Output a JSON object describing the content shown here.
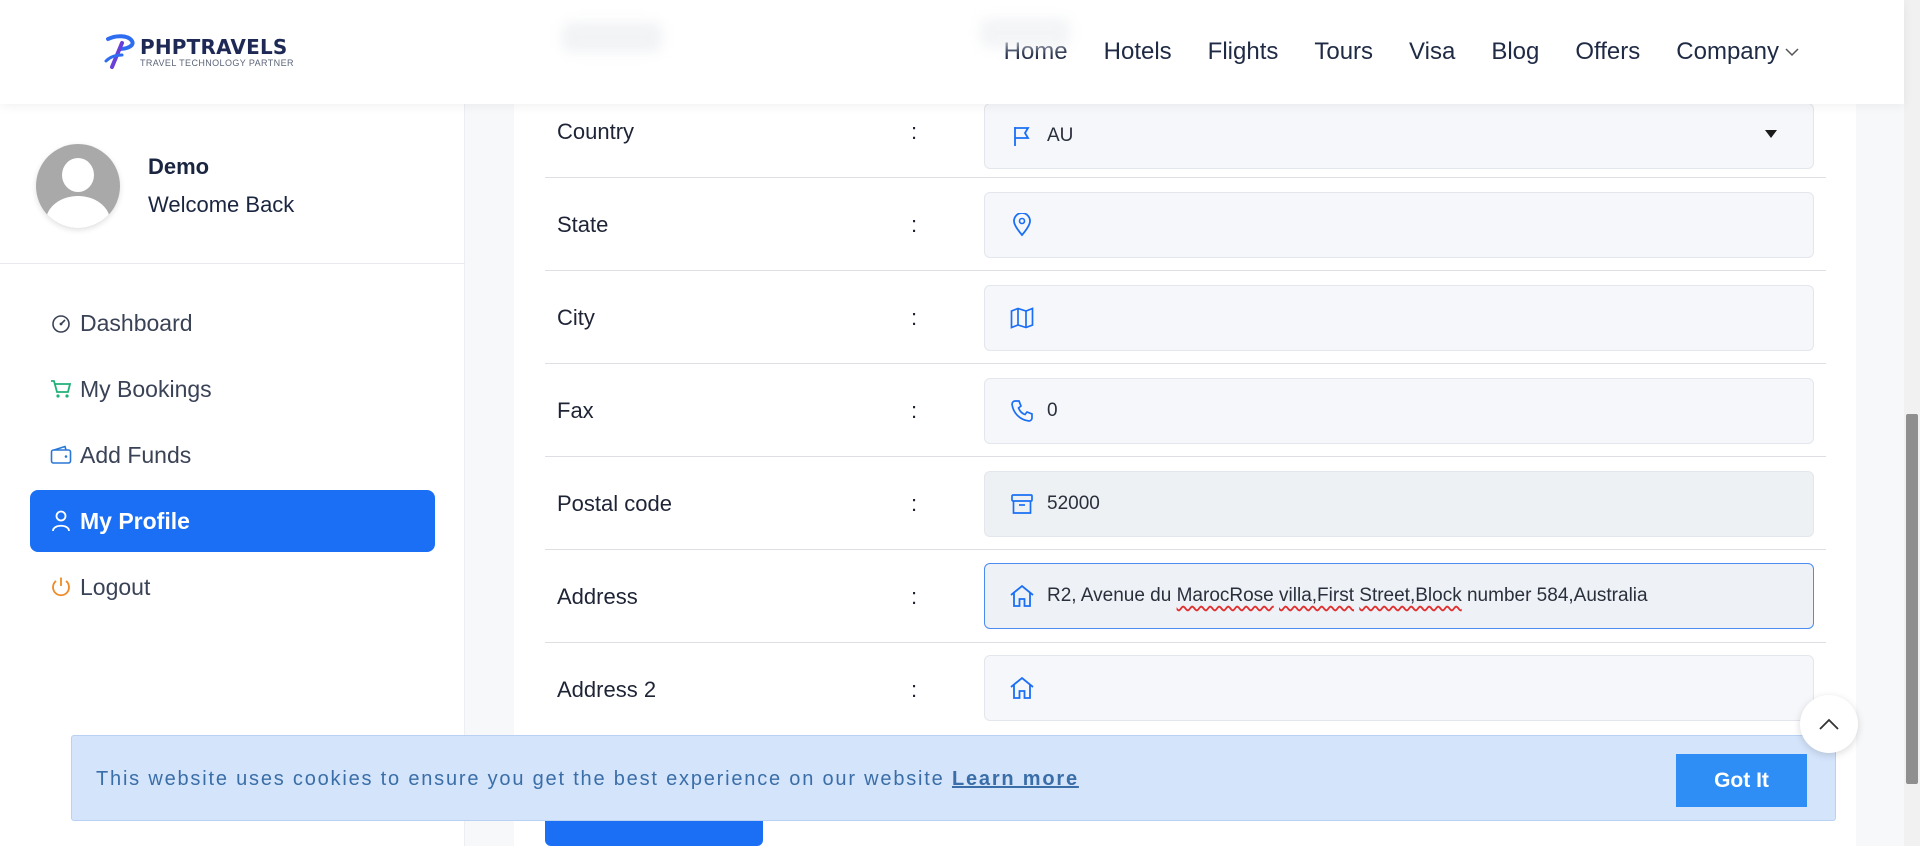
{
  "header": {
    "logo_title": "PHPTRAVELS",
    "logo_subtitle": "TRAVEL TECHNOLOGY PARTNER",
    "nav": [
      {
        "label": "Home"
      },
      {
        "label": "Hotels"
      },
      {
        "label": "Flights"
      },
      {
        "label": "Tours"
      },
      {
        "label": "Visa"
      },
      {
        "label": "Blog"
      },
      {
        "label": "Offers"
      },
      {
        "label": "Company"
      }
    ]
  },
  "sidebar": {
    "user_name": "Demo",
    "welcome": "Welcome Back",
    "items": [
      {
        "label": "Dashboard",
        "icon": "dashboard-gauge-icon"
      },
      {
        "label": "My Bookings",
        "icon": "cart-icon"
      },
      {
        "label": "Add Funds",
        "icon": "wallet-icon"
      },
      {
        "label": "My Profile",
        "icon": "user-icon"
      },
      {
        "label": "Logout",
        "icon": "power-icon"
      }
    ]
  },
  "form": {
    "rows": [
      {
        "label": "Country",
        "colon": ":",
        "value": "AU",
        "icon": "flag-icon"
      },
      {
        "label": "State",
        "colon": ":",
        "value": "",
        "icon": "map-pin-icon"
      },
      {
        "label": "City",
        "colon": ":",
        "value": "",
        "icon": "map-icon"
      },
      {
        "label": "Fax",
        "colon": ":",
        "value": "0",
        "icon": "phone-icon"
      },
      {
        "label": "Postal code",
        "colon": ":",
        "value": "52000",
        "icon": "archive-box-icon"
      },
      {
        "label": "Address",
        "colon": ":",
        "value": "R2, Avenue du MarocRose villa,First Street,Block number 584,Australia",
        "icon": "home-icon"
      },
      {
        "label": "Address 2",
        "colon": ":",
        "value": "",
        "icon": "home-icon"
      }
    ]
  },
  "cookie": {
    "text": "This website uses cookies to ensure you get the best experience on our website",
    "link": "Learn more",
    "button": "Got It"
  },
  "colors": {
    "accent": "#1b6ff5",
    "cookie_bg": "#d4e4fb",
    "cookie_button": "#2f8ef6",
    "icon_blue": "#1b6ff5"
  }
}
